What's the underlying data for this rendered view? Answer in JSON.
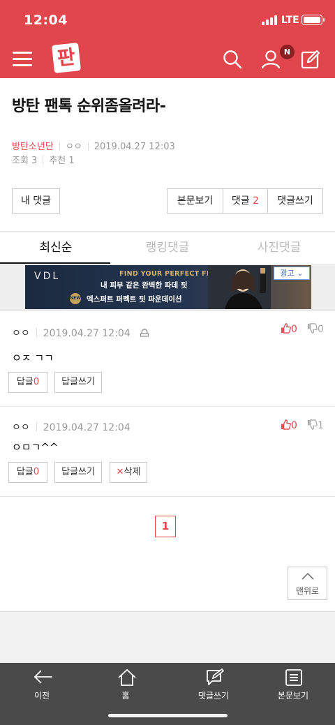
{
  "status_bar": {
    "time": "12:04",
    "network": "LTE"
  },
  "header": {
    "logo_text": "판",
    "notification_badge": "N"
  },
  "post": {
    "title": "방탄 팬톡 순위좀올려라-",
    "category": "방탄소년단",
    "author": "ㅇㅇ",
    "datetime": "2019.04.27 12:03",
    "views_label": "조회 3",
    "recommend_label": "추천 1"
  },
  "actions": {
    "my_comments": "내 댓글",
    "view_post": "본문보기",
    "comments_label": "댓글",
    "comments_count": "2",
    "write_comment": "댓글쓰기"
  },
  "tabs": [
    "최신순",
    "랭킹댓글",
    "사진댓글"
  ],
  "ad": {
    "brand": "VDL",
    "line1": "FIND YOUR PERFECT FIT",
    "line2": "내 피부 같은 완벽한 파데 핏",
    "line3": "엑스퍼트 퍼펙트 핏 파운데이션",
    "new_tag": "NEW",
    "badge": "광고 ⌄"
  },
  "comments": [
    {
      "author": "ㅇㅇ",
      "datetime": "2019.04.27 12:04",
      "body": "ㅇㅈ ㄱㄱ",
      "up": "0",
      "down": "0",
      "reply_label": "답글",
      "reply_count": "0",
      "write_reply": "답글쓰기"
    },
    {
      "author": "ㅇㅇ",
      "datetime": "2019.04.27 12:04",
      "body": "ㅇㅁㄱ^^",
      "up": "0",
      "down": "1",
      "reply_label": "답글",
      "reply_count": "0",
      "write_reply": "답글쓰기",
      "delete_label": "삭제"
    }
  ],
  "pagination": {
    "current": "1"
  },
  "top_button": "맨위로",
  "bottom_nav": [
    "이전",
    "홈",
    "댓글쓰기",
    "본문보기"
  ],
  "colors": {
    "brand_red": "#e0464b",
    "nav_bg": "#4a4a4a"
  }
}
